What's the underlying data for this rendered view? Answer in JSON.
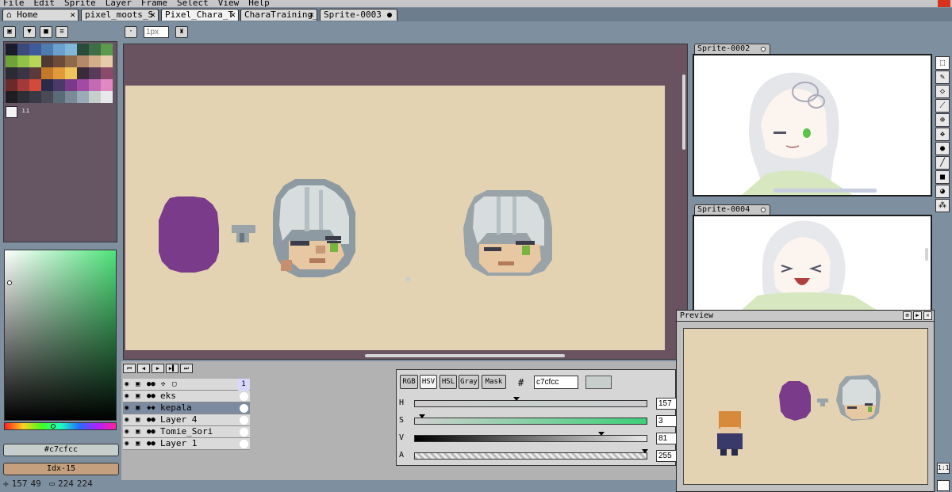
{
  "menu": [
    "File",
    "Edit",
    "Sprite",
    "Layer",
    "Frame",
    "Select",
    "View",
    "Help"
  ],
  "tabs": [
    {
      "label": "Home",
      "closable": true
    },
    {
      "label": "pixel_moots_S",
      "closable": true
    },
    {
      "label": "Pixel_Chara_T",
      "closable": true,
      "active": true
    },
    {
      "label": "CharaTraining_",
      "closable": true
    },
    {
      "label": "Sprite-0003",
      "modified": true
    }
  ],
  "toolbar": {
    "brush_size_placeholder": "1px"
  },
  "palette": {
    "colors": [
      "#1a1c2c",
      "#3b4a7a",
      "#3f5b9b",
      "#4f7cb0",
      "#6aa0cc",
      "#7fb8d8",
      "#2a4b3a",
      "#3e6e45",
      "#5a9a4a",
      "#6fa33a",
      "#93c24a",
      "#b7d65a",
      "#4e3a32",
      "#6e4a3a",
      "#8e6a4a",
      "#b48a6a",
      "#d4ae8a",
      "#e6ccaa",
      "#2c2a33",
      "#3a3542",
      "#5a3a3a",
      "#c27a2a",
      "#e09a3a",
      "#efc45a",
      "#3a2a3a",
      "#5a3a5a",
      "#8a4a6a",
      "#6a2a2a",
      "#a33a3a",
      "#d24a3a",
      "#2a2a4a",
      "#4a3a6a",
      "#7a3a8a",
      "#a34aa3",
      "#c46ab4",
      "#e08ac4",
      "#1e1e22",
      "#2e2e36",
      "#3a3a46",
      "#4a4a56",
      "#5a6a76",
      "#7a8a96",
      "#9aaab6",
      "#c7cfcc",
      "#e8e8ec"
    ]
  },
  "color": {
    "hex_badge": "#c7cfcc",
    "index_badge": "Idx-15",
    "hex_input": "c7cfcc",
    "modes": [
      "RGB",
      "HSV",
      "HSL",
      "Gray",
      "Mask"
    ],
    "active_mode": "HSV",
    "sliders": [
      {
        "label": "H",
        "value": "157",
        "fraction": 0.44
      },
      {
        "label": "S",
        "value": "3",
        "fraction": 0.03
      },
      {
        "label": "V",
        "value": "81",
        "fraction": 0.81
      },
      {
        "label": "A",
        "value": "255",
        "fraction": 1.0
      }
    ]
  },
  "status": {
    "cursor_x": "157",
    "cursor_y": "49",
    "sprite_w": "224",
    "sprite_h": "224"
  },
  "timeline": {
    "frame_header": "1",
    "layers": [
      {
        "name": "eks",
        "active": false
      },
      {
        "name": "kepala",
        "active": true
      },
      {
        "name": "Layer 4",
        "active": false
      },
      {
        "name": "Tomie_Sori",
        "active": false
      },
      {
        "name": "Layer 1",
        "active": false
      }
    ]
  },
  "thumbnails": [
    {
      "title": "Sprite-0002"
    },
    {
      "title": "Sprite-0004"
    }
  ],
  "preview": {
    "title": "Preview",
    "zoom_label": "1:1"
  },
  "tools": [
    "marquee-icon",
    "pencil-icon",
    "eraser-icon",
    "eyedropper-icon",
    "zoom-icon",
    "move-icon",
    "fill-icon",
    "line-icon",
    "rectangle-icon",
    "blur-icon",
    "spray-icon"
  ]
}
